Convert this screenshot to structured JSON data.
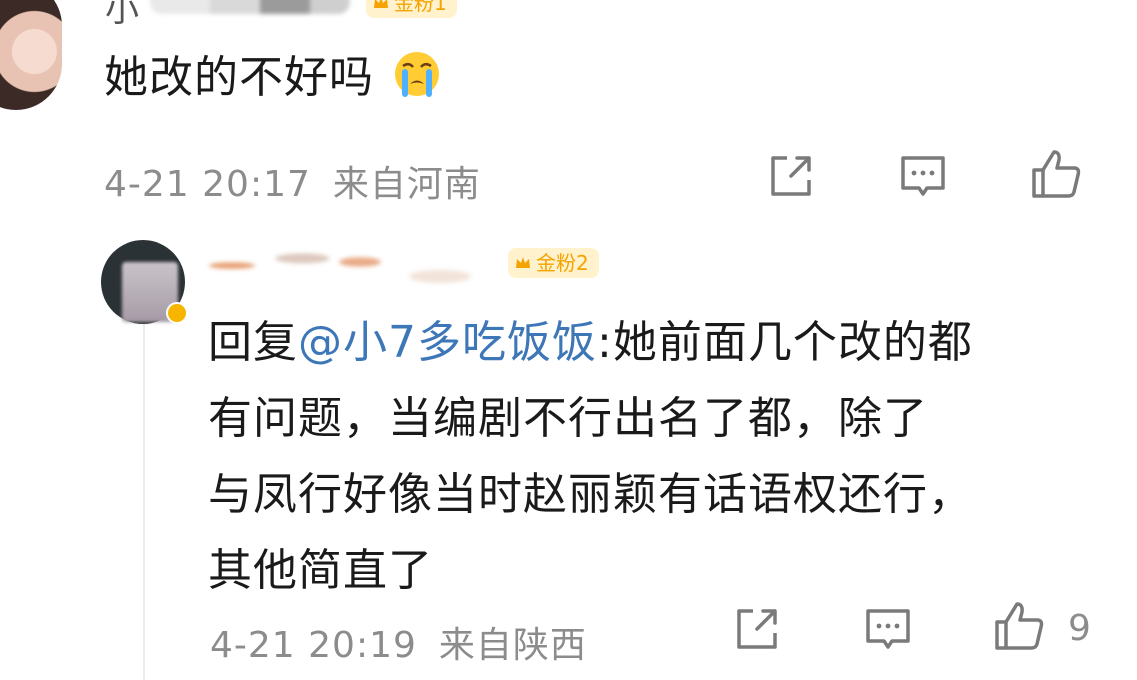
{
  "comment1": {
    "username_visible": "小",
    "badge_label": "金粉1",
    "text": "她改的不好吗",
    "emoji": "crying-face-emoji",
    "time": "4-21 20:17",
    "location": "来自河南",
    "icons": [
      "share-icon",
      "comment-icon",
      "like-icon"
    ]
  },
  "comment2": {
    "badge_label": "金粉2",
    "line1_prefix": "回复",
    "mention": "@小7多吃饭饭",
    "line1_suffix": ":她前面几个改的都",
    "line2": "有问题，当编剧不行出名了都，除了",
    "line3": "与凤行好像当时赵丽颖有话语权还行，",
    "line4": "其他简直了",
    "time": "4-21 20:19",
    "location": "来自陕西",
    "like_count": "9",
    "icons": [
      "share-icon",
      "comment-icon",
      "like-icon"
    ]
  },
  "colors": {
    "text": "#1a1a1a",
    "meta": "#8c8c8c",
    "mention": "#3d77b8",
    "badge_bg": "#fff2cc",
    "badge_text": "#f5a300"
  }
}
